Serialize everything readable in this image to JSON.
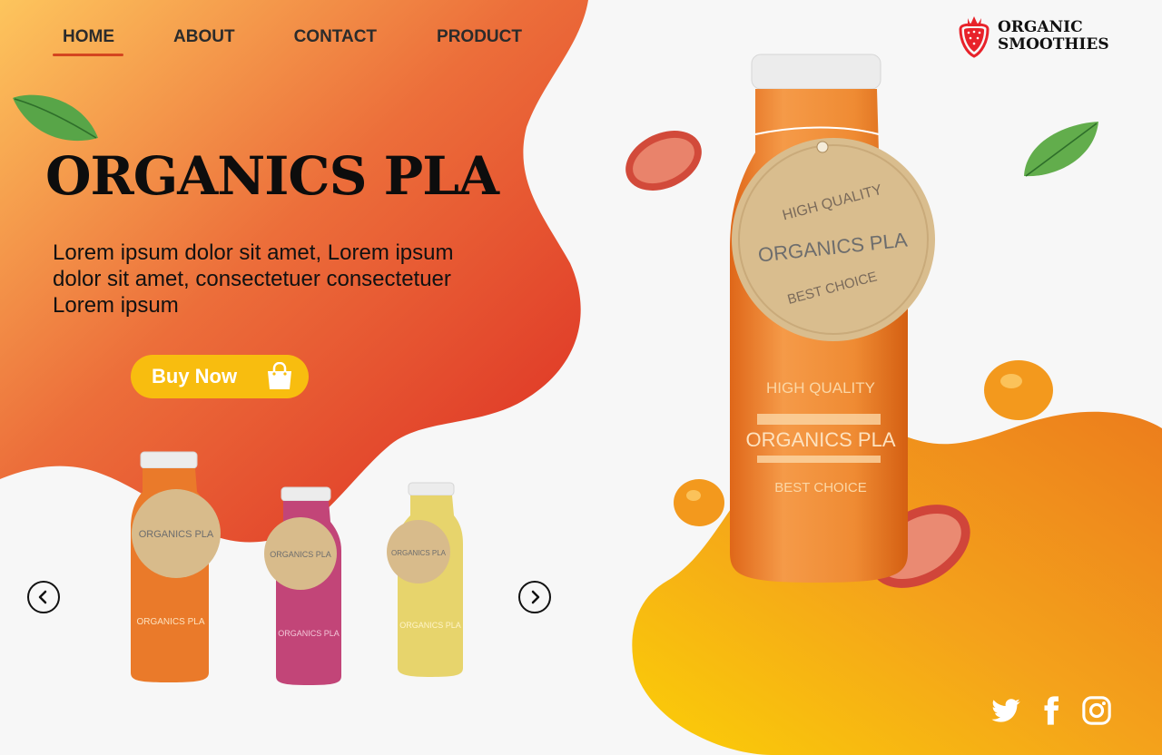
{
  "nav": {
    "items": [
      "HOME",
      "ABOUT",
      "CONTACT",
      "PRODUCT"
    ],
    "active": "HOME"
  },
  "brand": {
    "line1": "ORGANIC",
    "line2": "SMOOTHIES",
    "icon": "strawberry-icon"
  },
  "hero": {
    "title": "ORGANICS PLA",
    "description": "Lorem ipsum dolor sit amet, Lorem ipsum dolor sit amet, consectetuer  consectetuer Lorem ipsum",
    "buy_label": "Buy Now",
    "buy_icon": "shopping-bag-icon"
  },
  "label": {
    "top": "HIGH QUALITY",
    "brand": "ORGANICS PLA",
    "bottom": "BEST CHOICE"
  },
  "carousel": {
    "prev_icon": "chevron-left-icon",
    "next_icon": "chevron-right-icon",
    "bottles": [
      {
        "flavor": "orange",
        "color": "#e8782a"
      },
      {
        "flavor": "berry",
        "color": "#c2477a"
      },
      {
        "flavor": "lemon",
        "color": "#e4d06a"
      }
    ]
  },
  "social": [
    "twitter-icon",
    "facebook-icon",
    "instagram-icon"
  ],
  "colors": {
    "accent_orange": "#e4572e",
    "accent_red": "#dc2a22",
    "accent_yellow": "#f8bd0f",
    "text_dark": "#111111"
  }
}
